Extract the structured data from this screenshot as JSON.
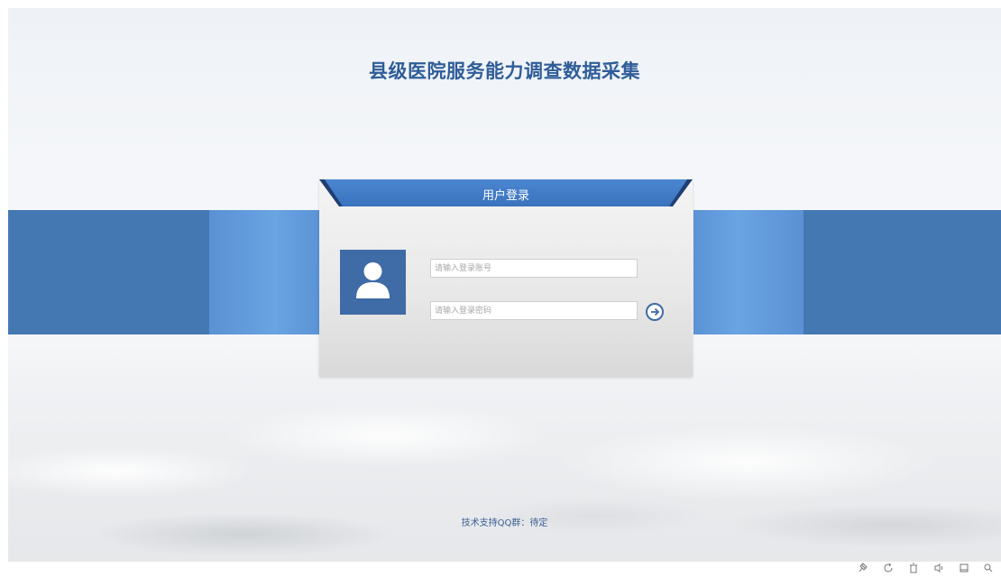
{
  "page": {
    "title": "县级医院服务能力调查数据采集"
  },
  "login": {
    "title": "用户登录",
    "account_placeholder": "请输入登录账号",
    "password_placeholder": "请输入登录密码",
    "submit_icon": "arrow-right-circle-icon",
    "avatar_icon": "user-silhouette-icon"
  },
  "footer": {
    "support_text": "技术支持QQ群：待定"
  },
  "taskbar": {
    "icons": [
      "pin-icon",
      "refresh-icon",
      "trash-icon",
      "speaker-icon",
      "window-icon",
      "search-icon"
    ]
  },
  "colors": {
    "title": "#2f5d98",
    "band_dark": "#4478b2",
    "band_light": "#6aa4e2",
    "header_blue": "#3d77c3",
    "avatar_bg": "#3f6ba6"
  }
}
